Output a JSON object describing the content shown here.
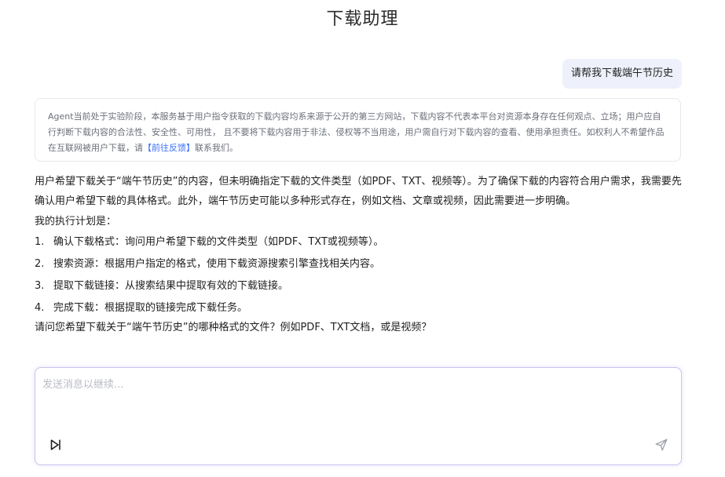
{
  "header": {
    "title": "下载助理"
  },
  "user_message": {
    "text": "请帮我下载端午节历史"
  },
  "disclaimer": {
    "text_before": "Agent当前处于实验阶段，本服务基于用户指令获取的下载内容均系来源于公开的第三方网站，下载内容不代表本平台对资源本身存在任何观点、立场；用户应自行判断下载内容的合法性、安全性、可用性， 且不要将下载内容用于非法、侵权等不当用途，用户需自行对下载内容的查看、使用承担责任。如权利人不希望作品在互联网被用户下载，请",
    "link_label": "【前往反馈】",
    "text_after": "联系我们。"
  },
  "assistant_message": {
    "intro": "用户希望下载关于“端午节历史”的内容，但未明确指定下载的文件类型（如PDF、TXT、视频等）。为了确保下载的内容符合用户需求，我需要先确认用户希望下载的具体格式。此外，端午节历史可能以多种形式存在，例如文档、文章或视频，因此需要进一步明确。",
    "plan_title": "我的执行计划是：",
    "steps": [
      {
        "num": "1.",
        "text": "确认下载格式：询问用户希望下载的文件类型（如PDF、TXT或视频等）。"
      },
      {
        "num": "2.",
        "text": "搜索资源：根据用户指定的格式，使用下载资源搜索引擎查找相关内容。"
      },
      {
        "num": "3.",
        "text": "提取下载链接：从搜索结果中提取有效的下载链接。"
      },
      {
        "num": "4.",
        "text": "完成下载：根据提取的链接完成下载任务。"
      }
    ],
    "question": "请问您希望下载关于“端午节历史”的哪种格式的文件？例如PDF、TXT文档，或是视频？"
  },
  "composer": {
    "placeholder": "发送消息以继续...",
    "value": "",
    "skip_icon": "skip-forward-icon",
    "send_icon": "send-icon"
  },
  "colors": {
    "accent": "#3a6ff7",
    "user_bubble_bg": "#eef1fb",
    "composer_border": "#c9c3ee"
  }
}
